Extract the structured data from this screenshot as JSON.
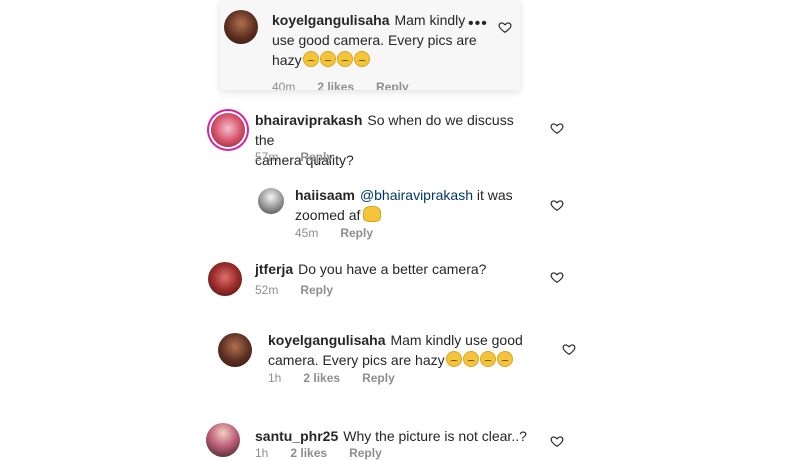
{
  "comments": [
    {
      "username": "koyelgangulisaha",
      "text": "Mam kindly use good camera. Every pics are hazy",
      "lines": [
        "Mam kindly",
        "use good camera. Every pics are",
        "hazy"
      ],
      "emoji_count": 4,
      "time": "40m",
      "likes": "2 likes",
      "reply": "Reply",
      "more": "•••"
    },
    {
      "username": "bhairaviprakash",
      "lines": [
        "So when do we discuss the",
        "camera quality?"
      ],
      "time": "57m",
      "reply": "Reply"
    },
    {
      "username": "haiisaam",
      "mention": "@bhairaviprakash",
      "lines": [
        "it was",
        "zoomed af"
      ],
      "time": "45m",
      "reply": "Reply"
    },
    {
      "username": "jtferja",
      "lines": [
        "Do you have a better camera?"
      ],
      "time": "52m",
      "reply": "Reply"
    },
    {
      "username": "koyelgangulisaha",
      "lines": [
        "Mam kindly use good",
        "camera. Every pics are hazy"
      ],
      "emoji_count": 4,
      "time": "1h",
      "likes": "2 likes",
      "reply": "Reply"
    },
    {
      "username": "santu_phr25",
      "lines": [
        "Why the picture is not clear..?"
      ],
      "time": "1h",
      "likes": "2 likes",
      "reply": "Reply"
    }
  ],
  "colors": {
    "text": "#262626",
    "meta": "#8e8e8e",
    "mention": "#00376b",
    "story_ring": "#d6249f"
  },
  "icons": {
    "like": "heart-outline-icon",
    "more": "more-horizontal-icon"
  }
}
